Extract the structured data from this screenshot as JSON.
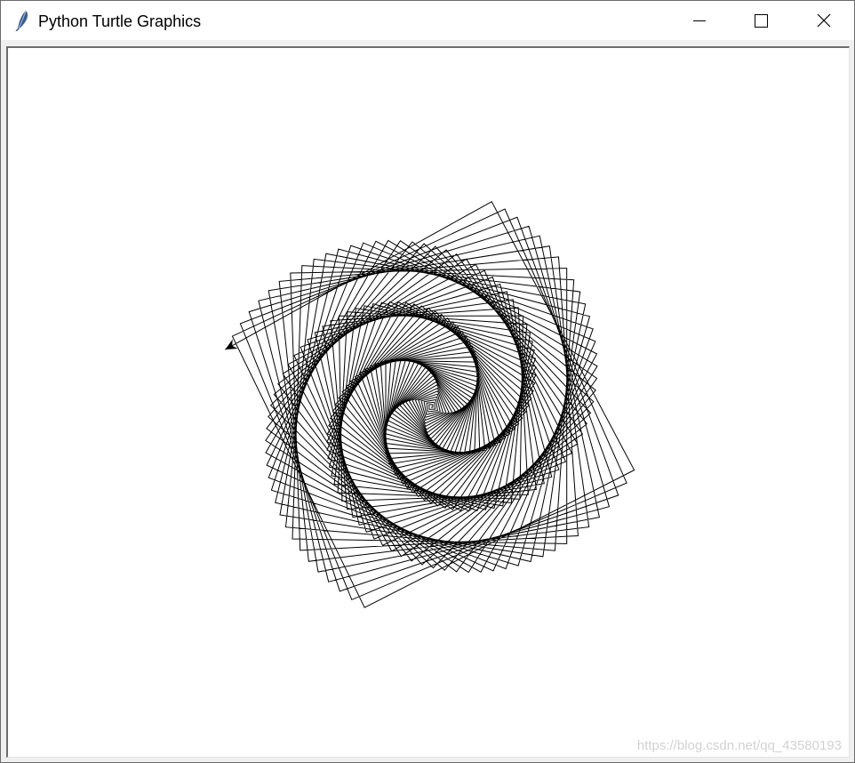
{
  "window": {
    "title": "Python Turtle Graphics",
    "icon": "feather-icon",
    "controls": {
      "minimize_icon": "minimize-icon",
      "maximize_icon": "maximize-icon",
      "close_icon": "close-icon"
    }
  },
  "canvas": {
    "background": "#ffffff",
    "pen_color": "#000000",
    "drawing": "spiral of rotated squares",
    "turtle_icon": "turtle-arrow-icon"
  },
  "watermark": {
    "text": "https://blog.csdn.net/qq_43580193"
  }
}
